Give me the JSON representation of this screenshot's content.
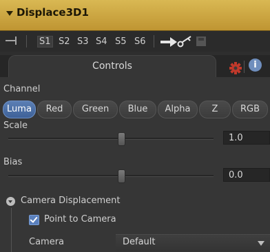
{
  "node": {
    "title": "Displace3D1"
  },
  "toolbar": {
    "slots": [
      "S1",
      "S2",
      "S3",
      "S4",
      "S5",
      "S6"
    ],
    "active_slot": "S1"
  },
  "tabs": {
    "controls_label": "Controls",
    "info_glyph": "i"
  },
  "channel": {
    "label": "Channel",
    "options": [
      "Luma",
      "Red",
      "Green",
      "Blue",
      "Alpha",
      "Z",
      "RGB"
    ],
    "selected": "Luma"
  },
  "scale": {
    "label": "Scale",
    "value_text": "1.0",
    "slider_fraction": 0.55
  },
  "bias": {
    "label": "Bias",
    "value_text": "0.0",
    "slider_fraction": 0.55
  },
  "camera_displacement": {
    "header": "Camera Displacement",
    "point_to_camera_label": "Point to Camera",
    "point_to_camera_checked": true,
    "camera_label": "Camera",
    "camera_value": "Default"
  },
  "colors": {
    "title_bar": "#c9a23e",
    "selected_button": "#4f72aa",
    "panel_bg": "#363636",
    "gear": "#c0392b",
    "info": "#6f8ebd"
  }
}
